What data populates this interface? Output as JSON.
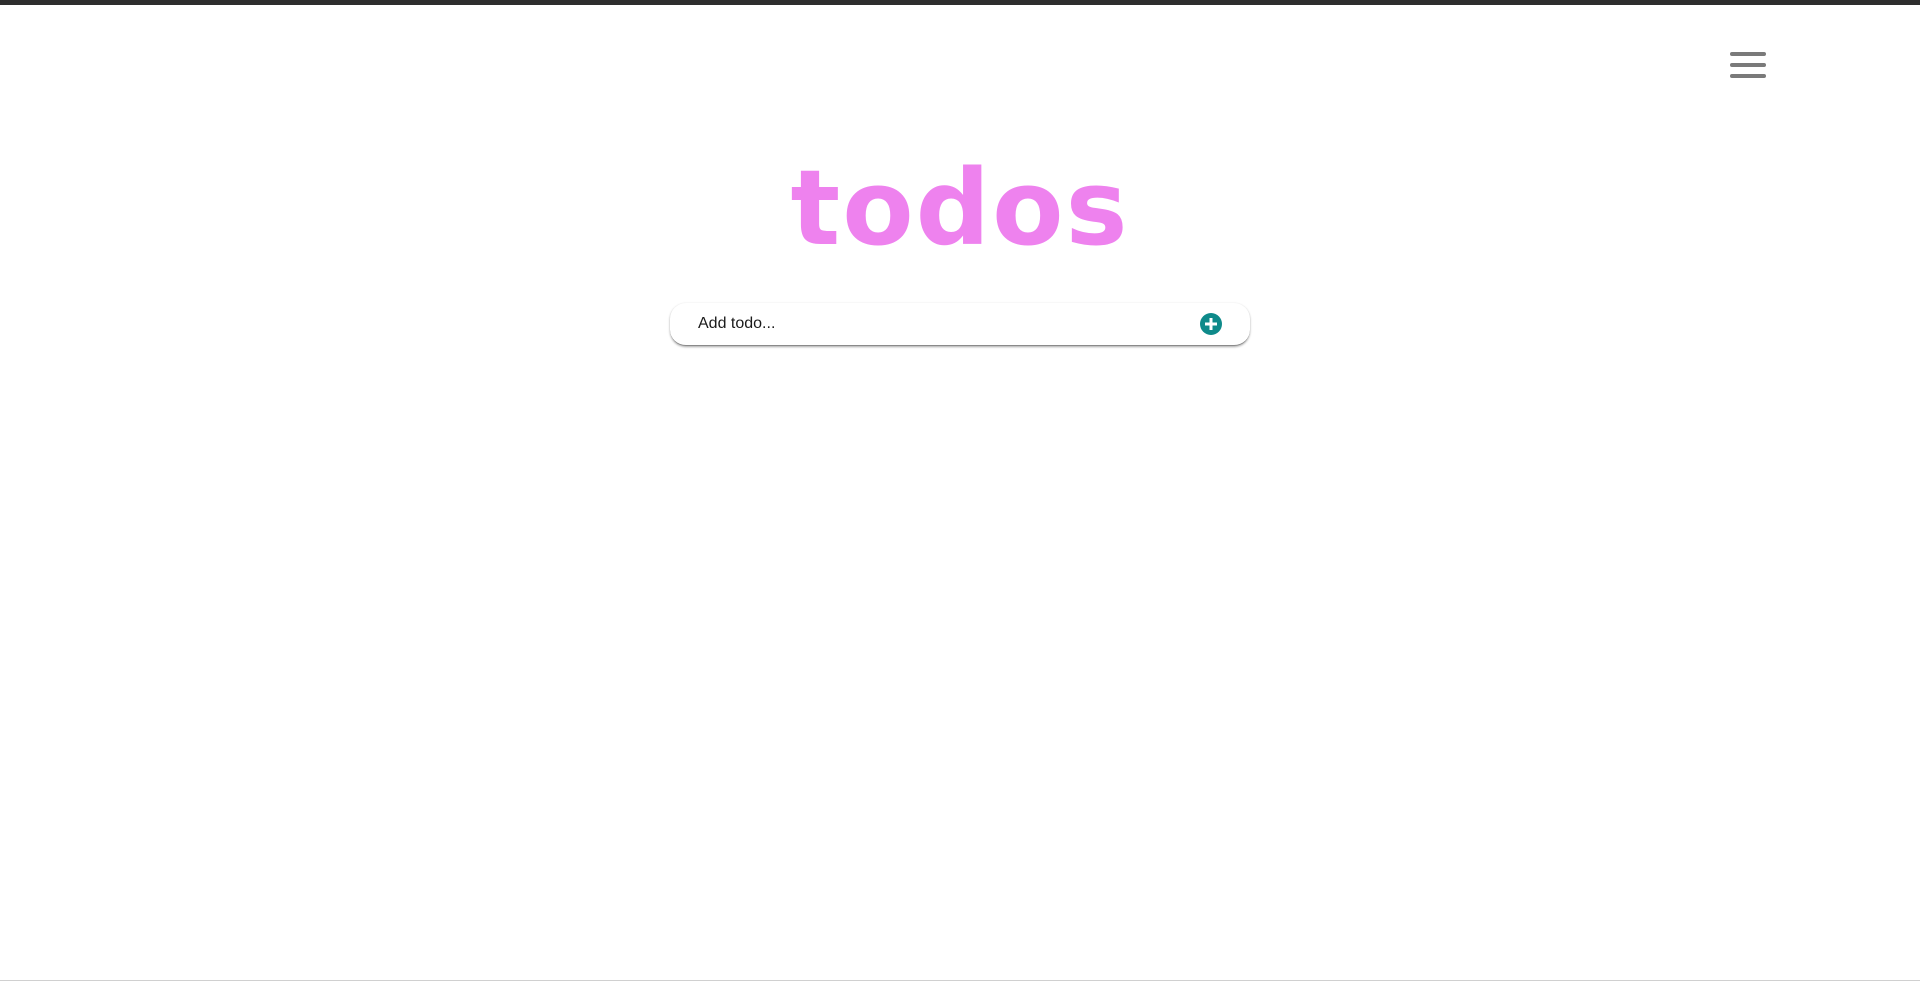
{
  "header": {
    "title": "todos",
    "menu_icon": "hamburger-menu-icon"
  },
  "add_todo": {
    "placeholder": "Add todo...",
    "value": "",
    "button_icon": "plus-circle-icon"
  },
  "colors": {
    "title": "#ee82ee",
    "accent": "#0e8a8a",
    "top_bar": "#2e2e2e"
  }
}
